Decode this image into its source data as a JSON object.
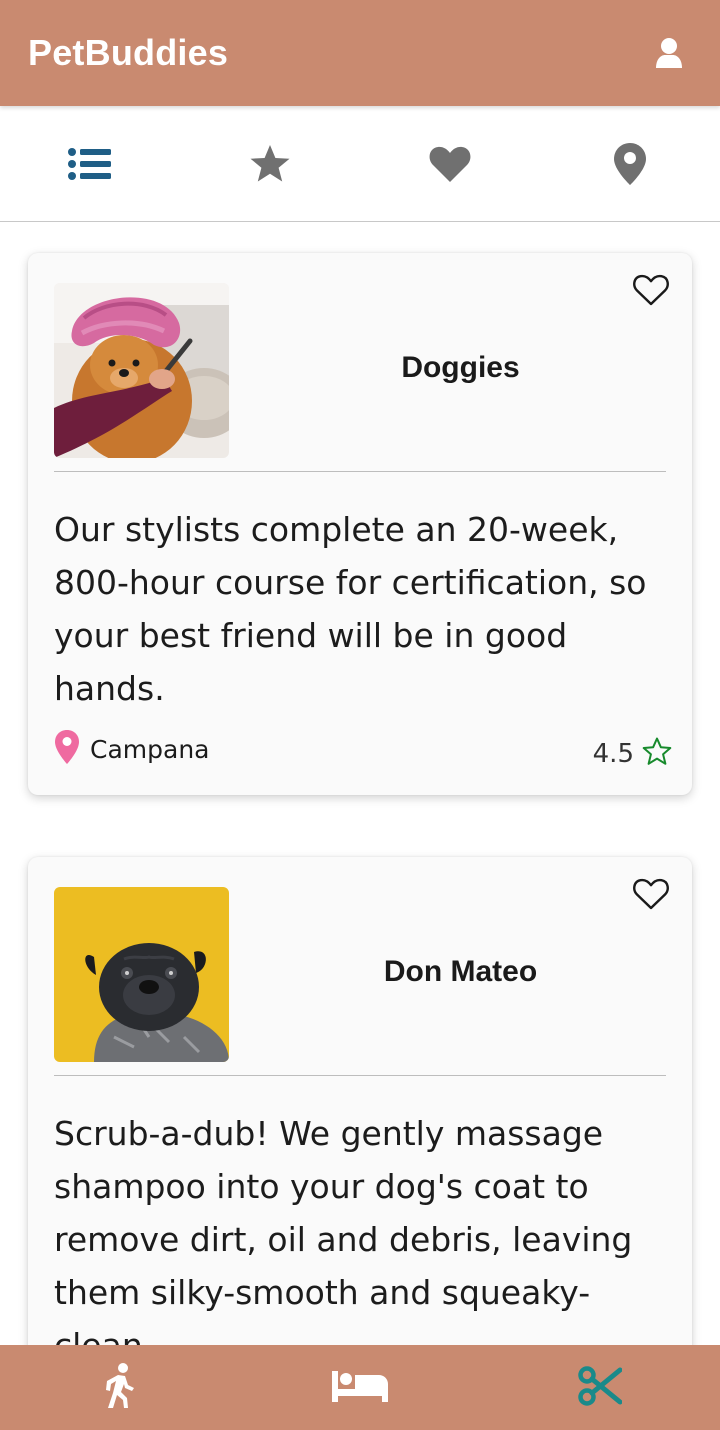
{
  "app": {
    "title": "PetBuddies",
    "accent_color": "#c98a70",
    "profile_icon": "user-icon"
  },
  "tabs": [
    {
      "name": "list",
      "icon": "list-icon",
      "active": true,
      "color": "#1f5e86"
    },
    {
      "name": "featured",
      "icon": "star-icon",
      "active": false,
      "color": "#707070"
    },
    {
      "name": "favorites",
      "icon": "heart-icon",
      "active": false,
      "color": "#707070"
    },
    {
      "name": "nearby",
      "icon": "map-pin-icon",
      "active": false,
      "color": "#707070"
    }
  ],
  "cards": [
    {
      "name": "Doggies",
      "description": "Our stylists complete an 20-week, 800-hour course for certification, so your best friend will be in good hands.",
      "location": "Campana",
      "rating": "4.5",
      "favorite": false
    },
    {
      "name": "Don Mateo",
      "description": "Scrub-a-dub! We gently massage shampoo into your dog's coat to remove dirt, oil and debris, leaving them silky-smooth and squeaky-clean.",
      "favorite": false
    }
  ],
  "bottom_nav": [
    {
      "name": "walking",
      "icon": "walking-person-icon",
      "active": false
    },
    {
      "name": "boarding",
      "icon": "bed-icon",
      "active": false
    },
    {
      "name": "grooming",
      "icon": "scissors-icon",
      "active": true,
      "active_color": "#1a8a8a"
    }
  ]
}
